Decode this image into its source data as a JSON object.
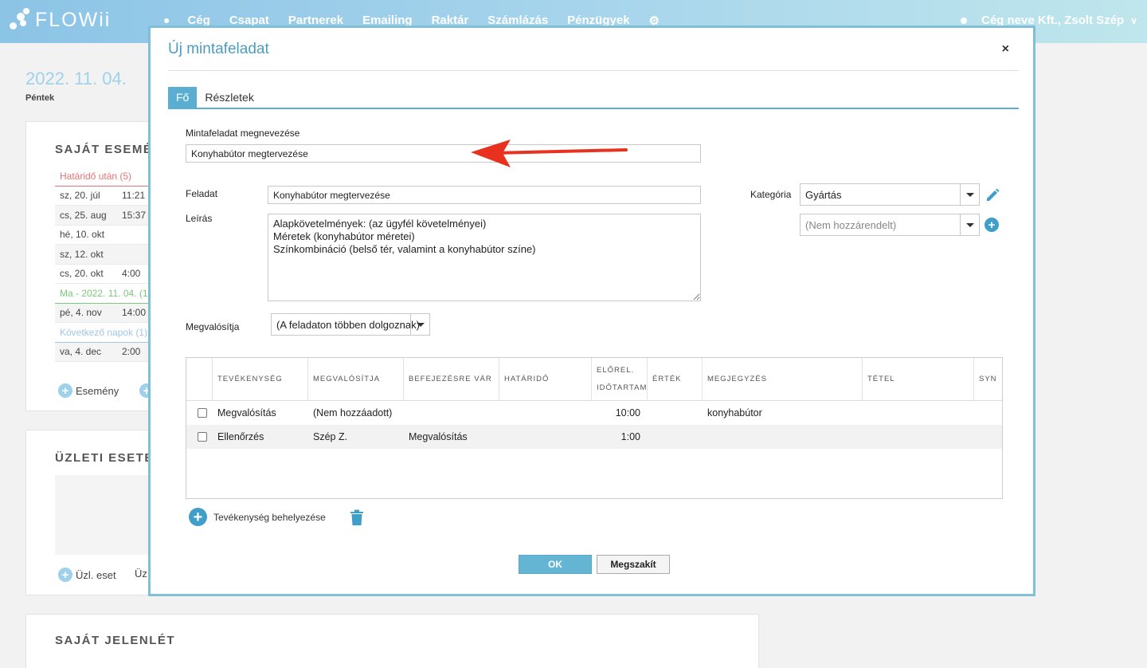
{
  "app": {
    "logo": "FLOWii"
  },
  "nav": {
    "items": [
      "Cég",
      "Csapat",
      "Partnerek",
      "Emailing",
      "Raktár",
      "Számlázás",
      "Pénzügyek"
    ]
  },
  "user": {
    "label": "Cég neve Kft., Zsolt Szép"
  },
  "dashboard": {
    "date": "2022. 11. 04.",
    "weekday": "Péntek",
    "events_title": "SAJÁT ESEMÉ",
    "events": [
      {
        "label": "Határidő után (5)",
        "time": "",
        "kind": "red"
      },
      {
        "label": "sz, 20. júl",
        "time": "11:21",
        "kind": "plain"
      },
      {
        "label": "cs, 25. aug",
        "time": "15:37",
        "kind": "shade"
      },
      {
        "label": "hé, 10. okt",
        "time": "",
        "kind": "plain"
      },
      {
        "label": "sz, 12. okt",
        "time": "",
        "kind": "shade"
      },
      {
        "label": "cs, 20. okt",
        "time": "4:00",
        "kind": "plain"
      },
      {
        "label": "Ma - 2022. 11. 04. (1",
        "time": "",
        "kind": "green"
      },
      {
        "label": "pé, 4. nov",
        "time": "14:00",
        "kind": "shade"
      },
      {
        "label": "Következő napok (1)",
        "time": "",
        "kind": "blue"
      },
      {
        "label": "va, 4. dec",
        "time": "2:00",
        "kind": "shade"
      }
    ],
    "events_add": "Esemény",
    "biz_title": "ÜZLETI ESETE",
    "biz_add": "Üzl. eset",
    "biz_add2": "Üz",
    "presence_title": "SAJÁT JELENLÉT"
  },
  "modal": {
    "title": "Új mintafeladat",
    "close": "×",
    "tabs": [
      "Fő",
      "Részletek"
    ],
    "name_label": "Mintafeladat megnevezése",
    "name_value": "Konyhabútor megtervezése",
    "task_label": "Feladat",
    "task_value": "Konyhabútor megtervezése",
    "desc_label": "Leírás",
    "desc_value": "Alapkövetelmények: (az ügyfél követelményei)\nMéretek (konyhabútor méretei)\nSzínkombináció (belső tér, valamint a konyhabútor színe)",
    "category_label": "Kategória",
    "category_value": "Gyártás",
    "subcategory_value": "(Nem hozzárendelt)",
    "performer_label": "Megvalósítja",
    "performer_value": "(A feladaton többen dolgoznak)",
    "table": {
      "headers": [
        "TEVÉKENYSÉG",
        "MEGVALÓSÍTJA",
        "BEFEJEZÉSRE VÁR",
        "HATÁRIDŐ",
        "ELŐREL.",
        "IDŐTARTAM",
        "ÉRTÉK",
        "MEGJEGYZÉS",
        "TÉTEL",
        "SYN"
      ],
      "rows": [
        {
          "activity": "Megvalósítás",
          "performer": "(Nem hozzáadott)",
          "waits_for": "",
          "deadline": "",
          "duration": "10:00",
          "value": "",
          "note": "konyhabútor",
          "item": ""
        },
        {
          "activity": "Ellenőrzés",
          "performer": "Szép Z.",
          "waits_for": "Megvalósítás",
          "deadline": "",
          "duration": "1:00",
          "value": "",
          "note": "",
          "item": ""
        }
      ]
    },
    "add_activity": "Tevékenység behelyezése",
    "ok": "OK",
    "cancel": "Megszakít"
  },
  "colors": {
    "accent": "#5aaed1",
    "annotation_arrow": "#e8321f"
  }
}
